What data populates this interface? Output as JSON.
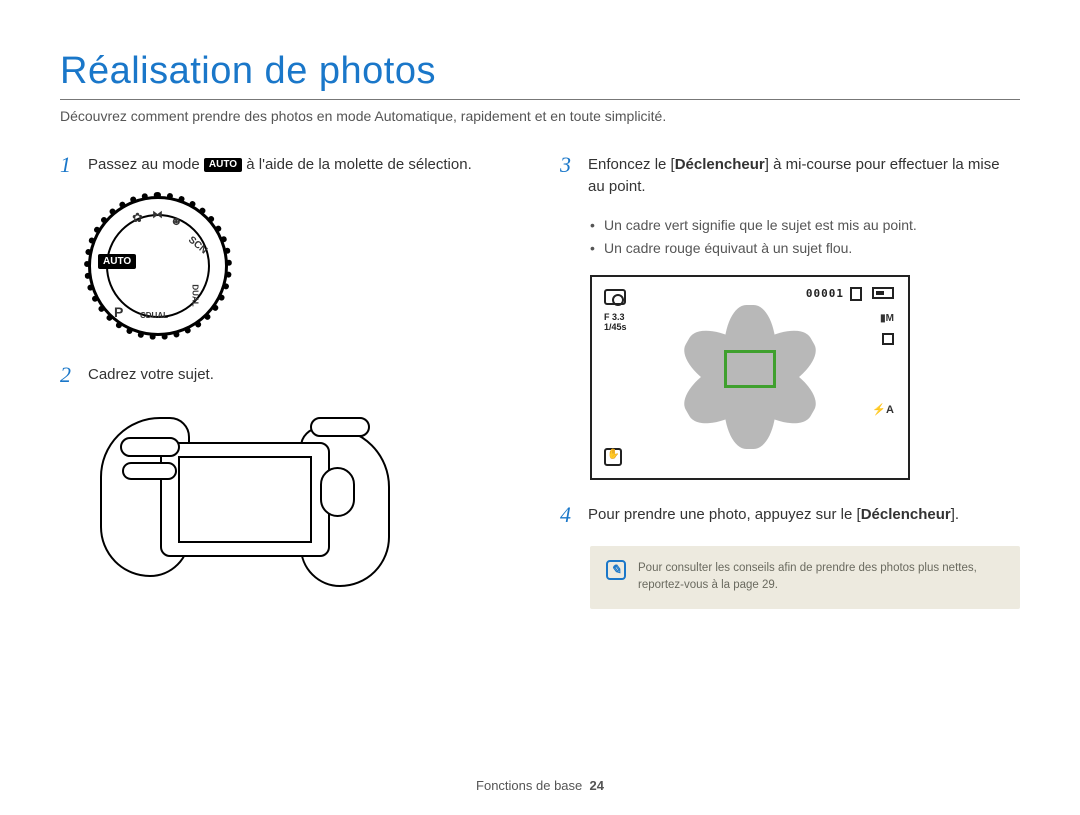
{
  "title": "Réalisation de photos",
  "subtitle": "Découvrez comment prendre des photos en mode Automatique, rapidement et en toute simplicité.",
  "steps": {
    "s1": {
      "num": "1",
      "pre": "Passez au mode ",
      "badge": "AUTO",
      "post": " à l'aide de la molette de sélection."
    },
    "s2": {
      "num": "2",
      "text": "Cadrez votre sujet."
    },
    "s3": {
      "num": "3",
      "pre": "Enfoncez le [",
      "bold1": "Déclencheur",
      "mid": "] à mi-course pour effectuer la mise au point."
    },
    "s3_bullets": {
      "b1": "Un cadre vert signifie que le sujet est mis au point.",
      "b2": "Un cadre rouge équivaut à un sujet flou."
    },
    "s4": {
      "num": "4",
      "pre": "Pour prendre une photo, appuyez sur le [",
      "bold1": "Déclencheur",
      "post": "]."
    }
  },
  "lcd": {
    "fnum": "F 3.3",
    "shutter": "1/45s",
    "counter": "00001",
    "size_label": "M",
    "flash_label": "A"
  },
  "dial": {
    "auto_label": "AUTO",
    "p_label": "P",
    "scn_label": "SCN",
    "dual_label": "DUAL",
    "cdual_label": "CDUAL"
  },
  "tip": {
    "icon_glyph": "✎",
    "text": "Pour consulter les conseils afin de prendre des photos plus nettes, reportez-vous à la page 29."
  },
  "footer": {
    "section": "Fonctions de base",
    "page": "24"
  }
}
